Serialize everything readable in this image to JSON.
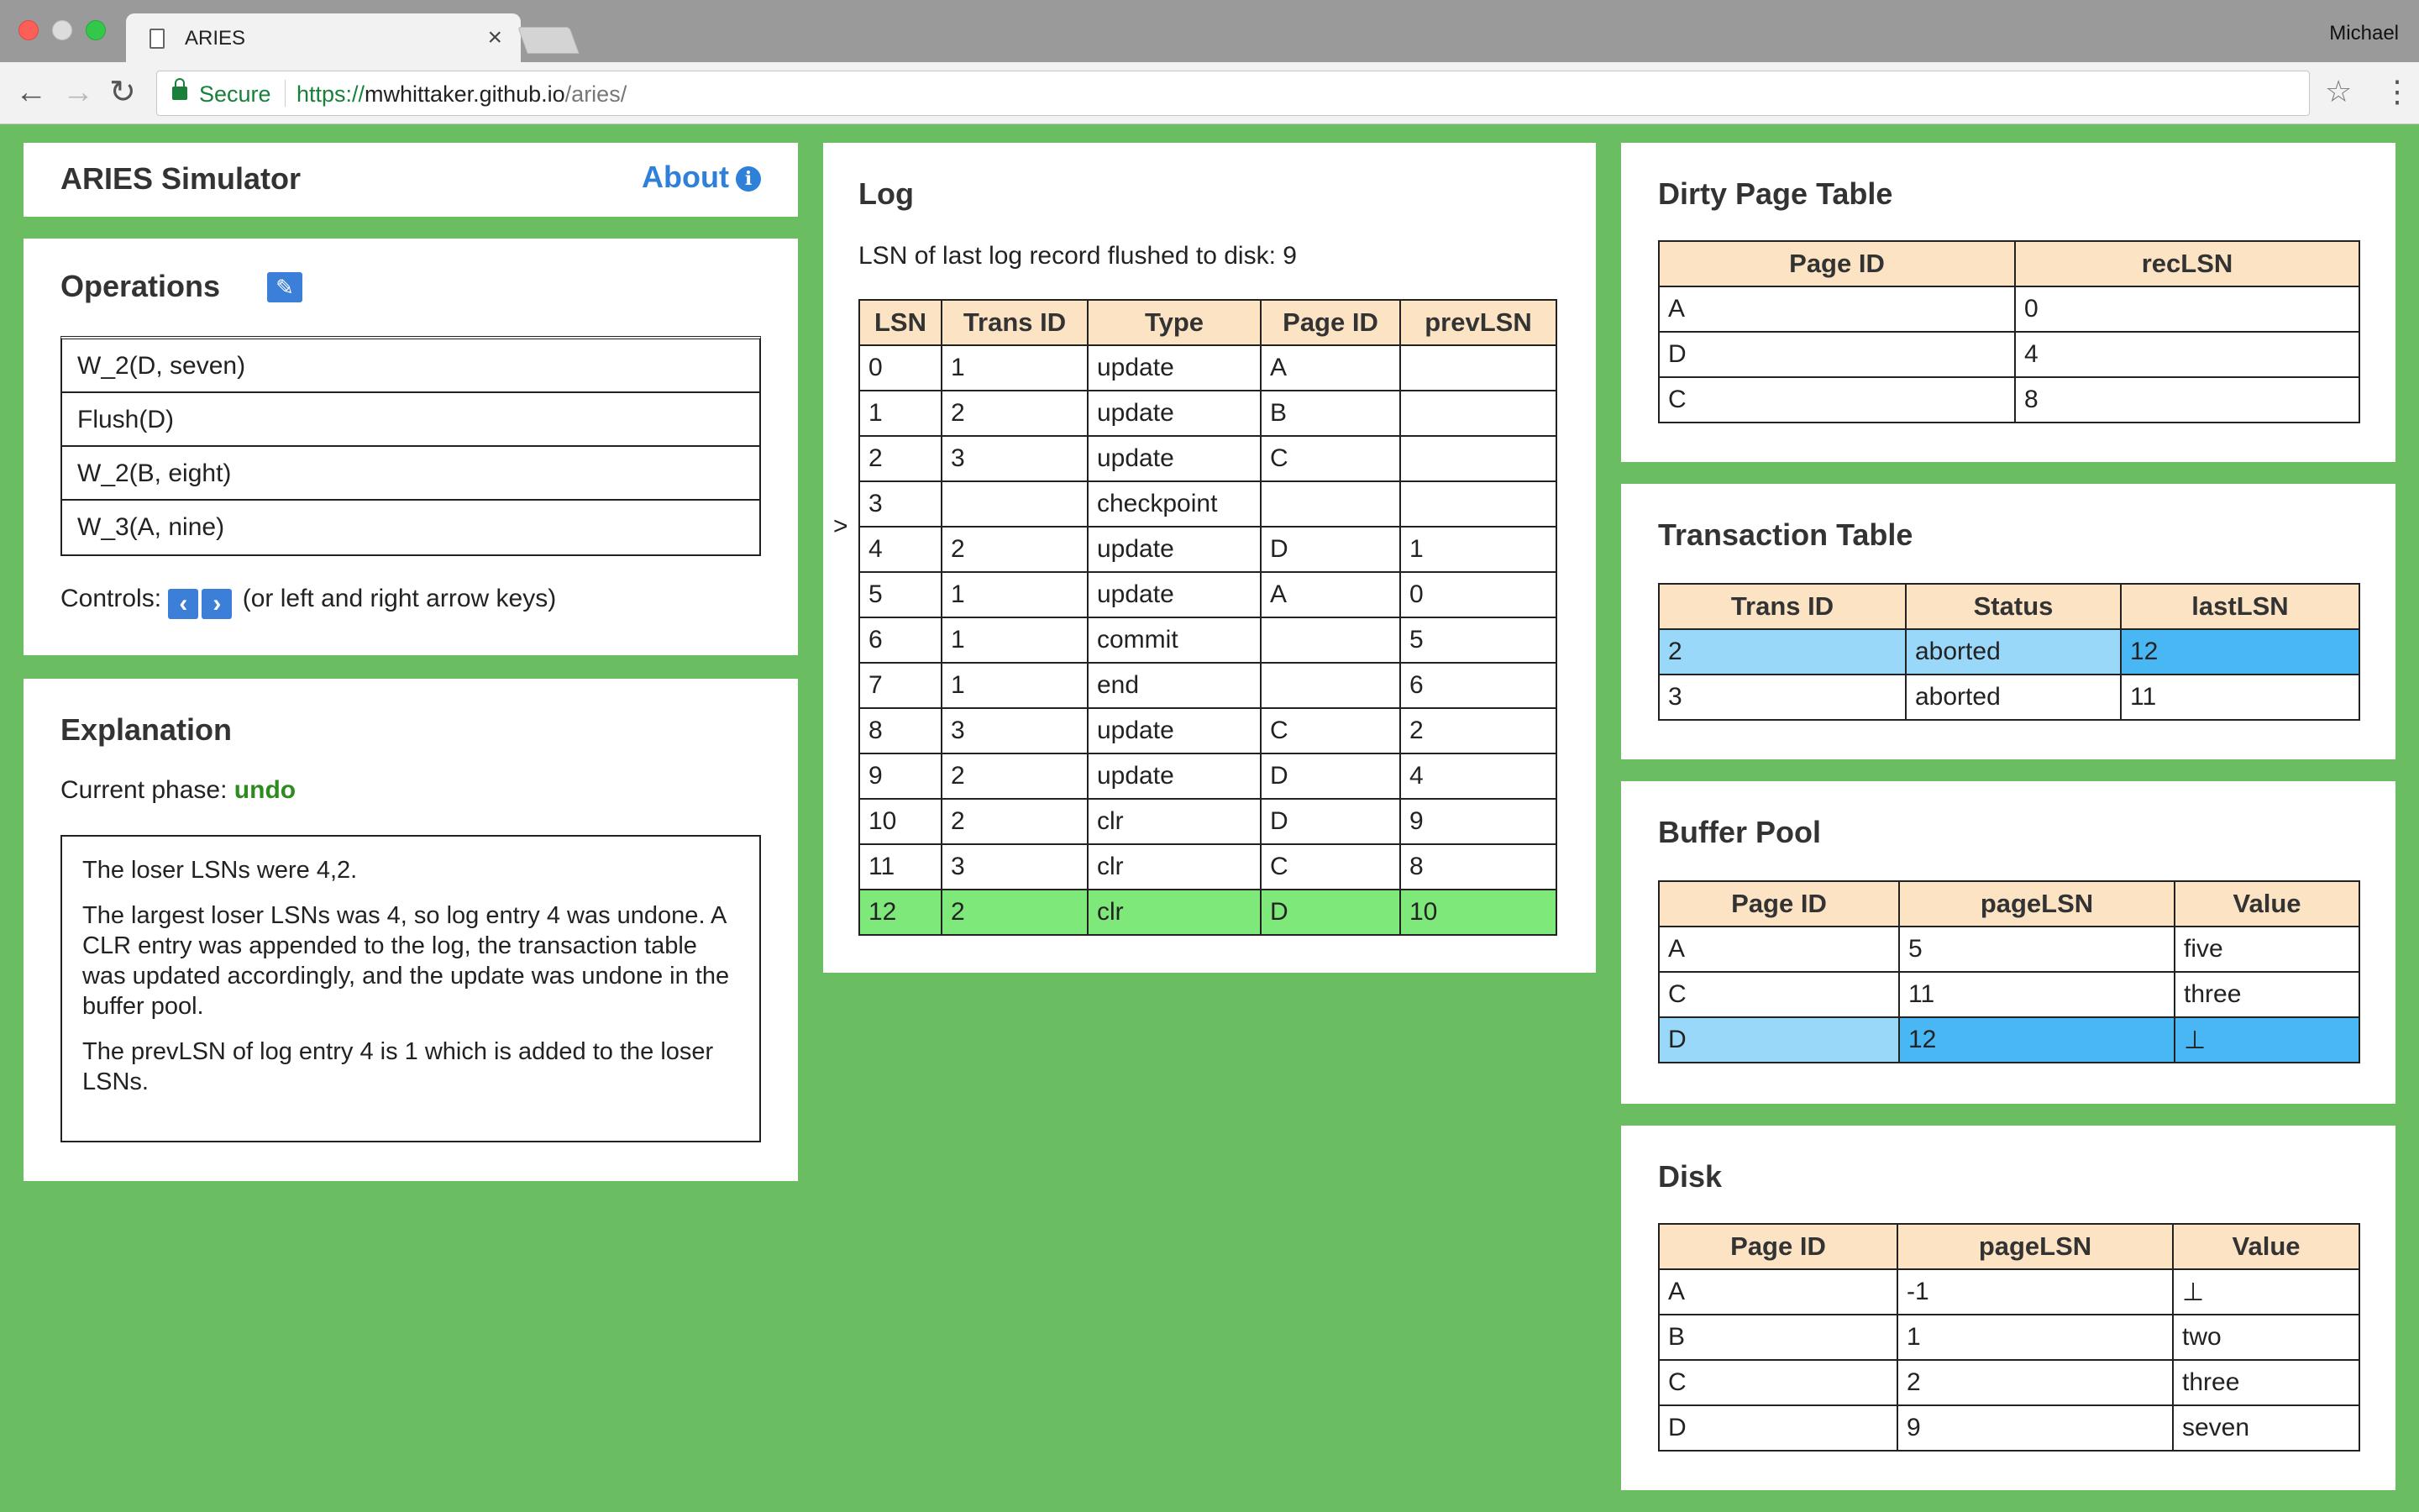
{
  "browser": {
    "tab_title": "ARIES",
    "tab_close": "×",
    "profile_name": "Michael",
    "secure_label": "Secure",
    "url_scheme": "https://",
    "url_host": "mwhittaker.github.io",
    "url_path": "/aries/",
    "back_glyph": "←",
    "forward_glyph": "→",
    "reload_glyph": "↻",
    "star_glyph": "☆",
    "menu_glyph": "⋮"
  },
  "header": {
    "title": "ARIES Simulator",
    "about_label": "About",
    "about_icon": "i"
  },
  "operations": {
    "title": "Operations",
    "edit_icon": "✎",
    "items": [
      "W_2(D, seven)",
      "Flush(D)",
      "W_2(B, eight)",
      "W_3(A, nine)"
    ],
    "controls_label": "Controls:",
    "prev_icon": "‹",
    "next_icon": "›",
    "controls_hint": "(or left and right arrow keys)"
  },
  "explanation": {
    "title": "Explanation",
    "phase_label": "Current phase:",
    "phase_value": "undo",
    "paragraphs": [
      "The loser LSNs were 4,2.",
      "The largest loser LSNs was 4, so log entry 4 was undone. A CLR entry was appended to the log, the transaction table was updated accordingly, and the update was undone in the buffer pool.",
      "The prevLSN of log entry 4 is 1 which is added to the loser LSNs."
    ]
  },
  "log": {
    "title": "Log",
    "flushed_text": "LSN of last log record flushed to disk: 9",
    "cursor": ">",
    "columns": [
      "LSN",
      "Trans ID",
      "Type",
      "Page ID",
      "prevLSN"
    ],
    "rows": [
      [
        "0",
        "1",
        "update",
        "A",
        ""
      ],
      [
        "1",
        "2",
        "update",
        "B",
        ""
      ],
      [
        "2",
        "3",
        "update",
        "C",
        ""
      ],
      [
        "3",
        "",
        "checkpoint",
        "",
        ""
      ],
      [
        "4",
        "2",
        "update",
        "D",
        "1"
      ],
      [
        "5",
        "1",
        "update",
        "A",
        "0"
      ],
      [
        "6",
        "1",
        "commit",
        "",
        "5"
      ],
      [
        "7",
        "1",
        "end",
        "",
        "6"
      ],
      [
        "8",
        "3",
        "update",
        "C",
        "2"
      ],
      [
        "9",
        "2",
        "update",
        "D",
        "4"
      ],
      [
        "10",
        "2",
        "clr",
        "D",
        "9"
      ],
      [
        "11",
        "3",
        "clr",
        "C",
        "8"
      ],
      [
        "12",
        "2",
        "clr",
        "D",
        "10"
      ]
    ]
  },
  "dirty_page_table": {
    "title": "Dirty Page Table",
    "columns": [
      "Page ID",
      "recLSN"
    ],
    "rows": [
      [
        "A",
        "0"
      ],
      [
        "D",
        "4"
      ],
      [
        "C",
        "8"
      ]
    ]
  },
  "transaction_table": {
    "title": "Transaction Table",
    "columns": [
      "Trans ID",
      "Status",
      "lastLSN"
    ],
    "rows": [
      [
        "2",
        "aborted",
        "12"
      ],
      [
        "3",
        "aborted",
        "11"
      ]
    ]
  },
  "buffer_pool": {
    "title": "Buffer Pool",
    "columns": [
      "Page ID",
      "pageLSN",
      "Value"
    ],
    "rows": [
      [
        "A",
        "5",
        "five"
      ],
      [
        "C",
        "11",
        "three"
      ],
      [
        "D",
        "12",
        "⊥"
      ]
    ]
  },
  "disk": {
    "title": "Disk",
    "columns": [
      "Page ID",
      "pageLSN",
      "Value"
    ],
    "rows": [
      [
        "A",
        "-1",
        "⊥"
      ],
      [
        "B",
        "1",
        "two"
      ],
      [
        "C",
        "2",
        "three"
      ],
      [
        "D",
        "9",
        "seven"
      ]
    ]
  },
  "highlight_colors": {
    "new_log_row": "#7ee87a",
    "updated_row": "#4ab7f5",
    "panel_background": "#6abd60",
    "table_header": "#fbe3c4"
  }
}
